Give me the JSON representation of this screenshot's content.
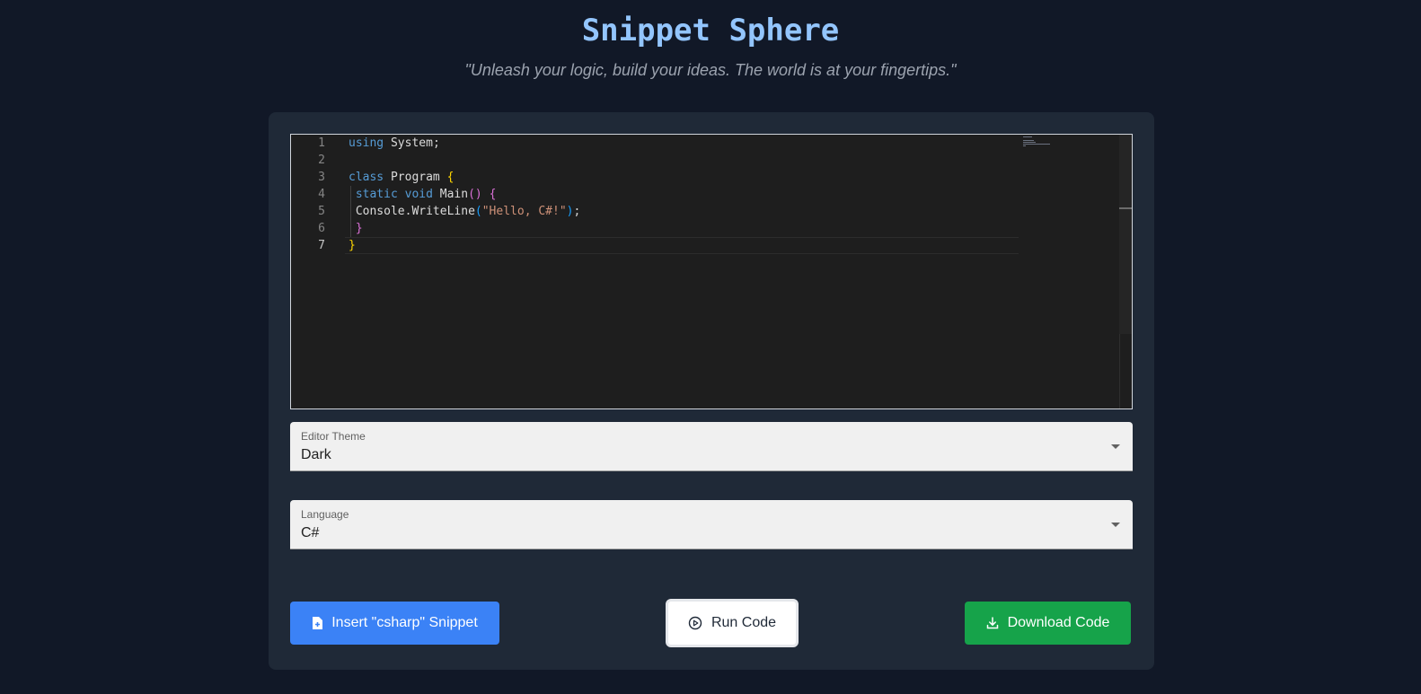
{
  "header": {
    "title": "Snippet Sphere",
    "subtitle": "\"Unleash your logic, build your ideas. The world is at your fingertips.\""
  },
  "editor": {
    "line_numbers": [
      "1",
      "2",
      "3",
      "4",
      "5",
      "6",
      "7"
    ],
    "active_line": 7,
    "lines": [
      "using System;",
      "",
      "class Program {",
      " static void Main() {",
      " Console.WriteLine(\"Hello, C#!\");",
      " }",
      "}"
    ]
  },
  "theme_select": {
    "label": "Editor Theme",
    "value": "Dark"
  },
  "language_select": {
    "label": "Language",
    "value": "C#"
  },
  "buttons": {
    "insert_label": "Insert \"csharp\" Snippet",
    "run_label": "Run Code",
    "download_label": "Download Code"
  },
  "colors": {
    "background": "#111827",
    "card": "#1f2937",
    "title": "#93c5fd",
    "insert_button": "#3b82f6",
    "download_button": "#16a34a"
  },
  "icons": {
    "insert": "file-plus-icon",
    "run": "play-circle-icon",
    "download": "download-icon",
    "select": "caret-down-icon"
  }
}
